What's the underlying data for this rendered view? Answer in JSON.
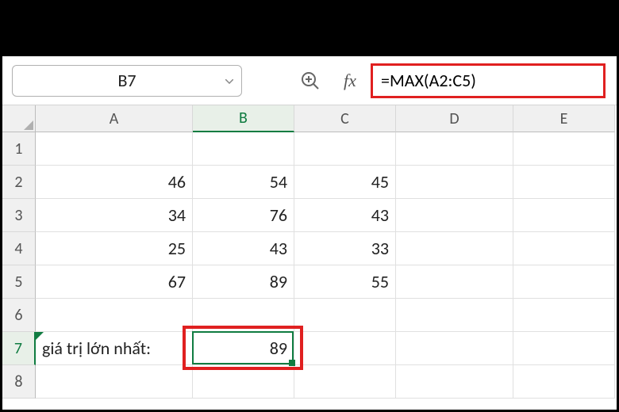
{
  "nameBox": {
    "value": "B7"
  },
  "formulaBar": {
    "value": "=MAX(A2:C5)"
  },
  "fxLabel": "fx",
  "columns": [
    "A",
    "B",
    "C",
    "D",
    "E"
  ],
  "rows": [
    "1",
    "2",
    "3",
    "4",
    "5",
    "6",
    "7",
    "8"
  ],
  "activeColumn": "B",
  "activeRow": "7",
  "gridData": {
    "A2": "46",
    "B2": "54",
    "C2": "45",
    "A3": "34",
    "B3": "76",
    "C3": "43",
    "A4": "25",
    "B4": "43",
    "C4": "33",
    "A5": "67",
    "B5": "89",
    "C5": "55",
    "A7": "giá trị lớn nhất:",
    "B7": "89"
  }
}
